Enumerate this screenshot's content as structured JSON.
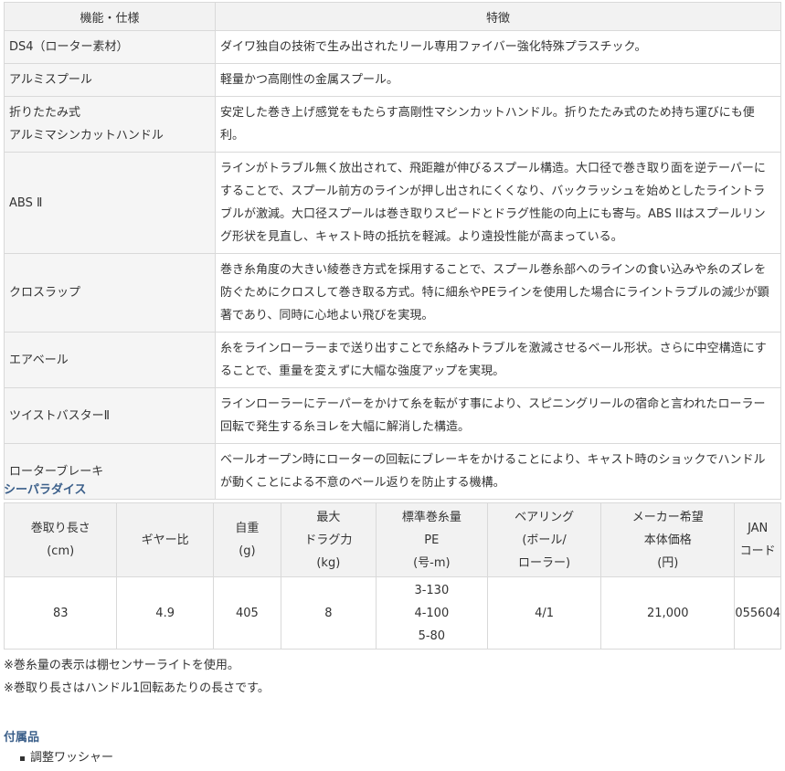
{
  "features": {
    "header_name": "機能・仕様",
    "header_desc": "特徴",
    "rows": [
      {
        "name": "DS4（ローター素材）",
        "desc": "ダイワ独自の技術で生み出されたリール専用ファイバー強化特殊プラスチック。"
      },
      {
        "name": "アルミスプール",
        "desc": "軽量かつ高剛性の金属スプール。"
      },
      {
        "name": "折りたたみ式\nアルミマシンカットハンドル",
        "desc": "安定した巻き上げ感覚をもたらす高剛性マシンカットハンドル。折りたたみ式のため持ち運びにも便利。"
      },
      {
        "name": "ABS Ⅱ",
        "desc": "ラインがトラブル無く放出されて、飛距離が伸びるスプール構造。大口径で巻き取り面を逆テーパーにすることで、スプール前方のラインが押し出されにくくなり、バックラッシュを始めとしたライントラブルが激減。大口径スプールは巻き取りスピードとドラグ性能の向上にも寄与。ABS IIはスプールリング形状を見直し、キャスト時の抵抗を軽減。より遠投性能が高まっている。"
      },
      {
        "name": "クロスラップ",
        "desc": "巻き糸角度の大きい綾巻き方式を採用することで、スプール巻糸部へのラインの食い込みや糸のズレを防ぐためにクロスして巻き取る方式。特に細糸やPEラインを使用した場合にライントラブルの減少が顕著であり、同時に心地よい飛びを実現。"
      },
      {
        "name": "エアベール",
        "desc": "糸をラインローラーまで送り出すことで糸絡みトラブルを激減させるベール形状。さらに中空構造にすることで、重量を変えずに大幅な強度アップを実現。"
      },
      {
        "name": "ツイストバスターⅡ",
        "desc": "ラインローラーにテーパーをかけて糸を転がす事により、スピニングリールの宿命と言われたローラー回転で発生する糸ヨレを大幅に解消した構造。"
      },
      {
        "name": "ローターブレーキ",
        "desc": "ベールオープン時にローターの回転にブレーキをかけることにより、キャスト時のショックでハンドルが動くことによる不意のベール返りを防止する機構。"
      }
    ]
  },
  "spec": {
    "heading": "シーパラダイス",
    "headers": [
      "巻取り長さ\n(cm)",
      "ギヤー比",
      "自重\n(g)",
      "最大\nドラグ力\n(kg)",
      "標準巻糸量\nPE\n(号-m)",
      "ベアリング\n(ボール/\nローラー)",
      "メーカー希望\n本体価格\n(円)",
      "JAN\nコード"
    ],
    "row": [
      "83",
      "4.9",
      "405",
      "8",
      "3-130\n4-100\n5-80",
      "4/1",
      "21,000",
      "055604"
    ]
  },
  "notes": [
    "※巻糸量の表示は棚センサーライトを使用。",
    "※巻取り長さはハンドル1回転あたりの長さです。"
  ],
  "accessories": {
    "heading": "付属品",
    "items": [
      "調整ワッシャー"
    ]
  }
}
